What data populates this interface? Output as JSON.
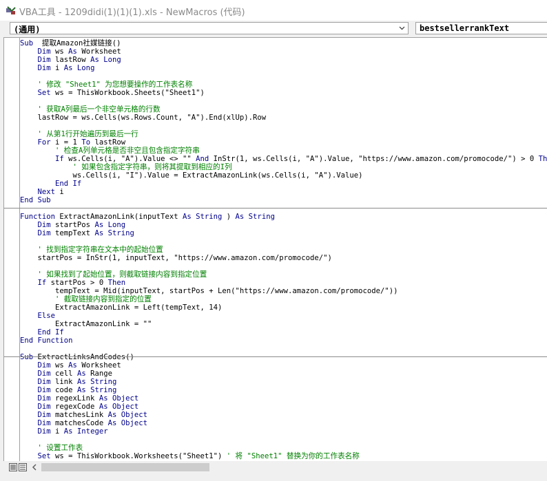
{
  "window": {
    "title": "VBA工具 - 1209didi(1)(1)(1).xls - NewMacros (代码)"
  },
  "object_combo": {
    "value": "(通用)"
  },
  "procedure_combo": {
    "value": "bestsellerrankText"
  },
  "code_lines": [
    [
      [
        "kw",
        "Sub"
      ],
      [
        "",
        "  提取Amazon社媒链接()"
      ]
    ],
    [
      [
        "",
        "    "
      ],
      [
        "kw",
        "Dim"
      ],
      [
        "",
        " ws "
      ],
      [
        "kw",
        "As"
      ],
      [
        "",
        " Worksheet"
      ]
    ],
    [
      [
        "",
        "    "
      ],
      [
        "kw",
        "Dim"
      ],
      [
        "",
        " lastRow "
      ],
      [
        "kw",
        "As Long"
      ]
    ],
    [
      [
        "",
        "    "
      ],
      [
        "kw",
        "Dim"
      ],
      [
        "",
        " i "
      ],
      [
        "kw",
        "As Long"
      ]
    ],
    [],
    [
      [
        "cm",
        "    ' 修改 \"Sheet1\" 为您想要操作的工作表名称"
      ]
    ],
    [
      [
        "",
        "    "
      ],
      [
        "kw",
        "Set"
      ],
      [
        "",
        " ws = ThisWorkbook.Sheets(\"Sheet1\")"
      ]
    ],
    [],
    [
      [
        "cm",
        "    ' 获取A列最后一个非空单元格的行数"
      ]
    ],
    [
      [
        "",
        "    lastRow = ws.Cells(ws.Rows.Count, \"A\").End(xlUp).Row"
      ]
    ],
    [],
    [
      [
        "cm",
        "    ' 从第1行开始遍历到最后一行"
      ]
    ],
    [
      [
        "",
        "    "
      ],
      [
        "kw",
        "For"
      ],
      [
        "",
        " i = 1 "
      ],
      [
        "kw",
        "To"
      ],
      [
        "",
        " lastRow"
      ]
    ],
    [
      [
        "cm",
        "        ' 检查A列单元格是否非空且包含指定字符串"
      ]
    ],
    [
      [
        "",
        "        "
      ],
      [
        "kw",
        "If"
      ],
      [
        "",
        " ws.Cells(i, \"A\").Value <> \"\" "
      ],
      [
        "kw",
        "And"
      ],
      [
        "",
        " InStr(1, ws.Cells(i, \"A\").Value, \"https://www.amazon.com/promocode/\") > 0 "
      ],
      [
        "kw",
        "Then"
      ]
    ],
    [
      [
        "cm",
        "            ' 如果包含指定字符串，则将其提取到相应的I列"
      ]
    ],
    [
      [
        "",
        "            ws.Cells(i, \"I\").Value = ExtractAmazonLink(ws.Cells(i, \"A\").Value)"
      ]
    ],
    [
      [
        "",
        "        "
      ],
      [
        "kw",
        "End If"
      ]
    ],
    [
      [
        "",
        "    "
      ],
      [
        "kw",
        "Next"
      ],
      [
        "",
        " i"
      ]
    ],
    [
      [
        "kw",
        "End Sub"
      ]
    ],
    [],
    [
      [
        "kw",
        "Function"
      ],
      [
        "",
        " ExtractAmazonLink(inputText "
      ],
      [
        "kw",
        "As String"
      ],
      [
        "",
        " ) "
      ],
      [
        "kw",
        "As String"
      ]
    ],
    [
      [
        "",
        "    "
      ],
      [
        "kw",
        "Dim"
      ],
      [
        "",
        " startPos "
      ],
      [
        "kw",
        "As Long"
      ]
    ],
    [
      [
        "",
        "    "
      ],
      [
        "kw",
        "Dim"
      ],
      [
        "",
        " tempText "
      ],
      [
        "kw",
        "As String"
      ]
    ],
    [],
    [
      [
        "cm",
        "    ' 找到指定字符串在文本中的起始位置"
      ]
    ],
    [
      [
        "",
        "    startPos = InStr(1, inputText, \"https://www.amazon.com/promocode/\")"
      ]
    ],
    [],
    [
      [
        "cm",
        "    ' 如果找到了起始位置，则截取链接内容到指定位置"
      ]
    ],
    [
      [
        "",
        "    "
      ],
      [
        "kw",
        "If"
      ],
      [
        "",
        " startPos > 0 "
      ],
      [
        "kw",
        "Then"
      ]
    ],
    [
      [
        "",
        "        tempText = Mid(inputText, startPos + Len(\"https://www.amazon.com/promocode/\"))"
      ]
    ],
    [
      [
        "cm",
        "        ' 截取链接内容到指定的位置"
      ]
    ],
    [
      [
        "",
        "        ExtractAmazonLink = Left(tempText, 14)"
      ]
    ],
    [
      [
        "",
        "    "
      ],
      [
        "kw",
        "Else"
      ]
    ],
    [
      [
        "",
        "        ExtractAmazonLink = \"\""
      ]
    ],
    [
      [
        "",
        "    "
      ],
      [
        "kw",
        "End If"
      ]
    ],
    [
      [
        "kw",
        "End Function"
      ]
    ],
    [],
    [
      [
        "kw",
        "Sub"
      ],
      [
        "",
        " ExtractLinksAndCodes()"
      ]
    ],
    [
      [
        "",
        "    "
      ],
      [
        "kw",
        "Dim"
      ],
      [
        "",
        " ws "
      ],
      [
        "kw",
        "As"
      ],
      [
        "",
        " Worksheet"
      ]
    ],
    [
      [
        "",
        "    "
      ],
      [
        "kw",
        "Dim"
      ],
      [
        "",
        " cell "
      ],
      [
        "kw",
        "As"
      ],
      [
        "",
        " Range"
      ]
    ],
    [
      [
        "",
        "    "
      ],
      [
        "kw",
        "Dim"
      ],
      [
        "",
        " link "
      ],
      [
        "kw",
        "As String"
      ]
    ],
    [
      [
        "",
        "    "
      ],
      [
        "kw",
        "Dim"
      ],
      [
        "",
        " code "
      ],
      [
        "kw",
        "As String"
      ]
    ],
    [
      [
        "",
        "    "
      ],
      [
        "kw",
        "Dim"
      ],
      [
        "",
        " regexLink "
      ],
      [
        "kw",
        "As Object"
      ]
    ],
    [
      [
        "",
        "    "
      ],
      [
        "kw",
        "Dim"
      ],
      [
        "",
        " regexCode "
      ],
      [
        "kw",
        "As Object"
      ]
    ],
    [
      [
        "",
        "    "
      ],
      [
        "kw",
        "Dim"
      ],
      [
        "",
        " matchesLink "
      ],
      [
        "kw",
        "As Object"
      ]
    ],
    [
      [
        "",
        "    "
      ],
      [
        "kw",
        "Dim"
      ],
      [
        "",
        " matchesCode "
      ],
      [
        "kw",
        "As Object"
      ]
    ],
    [
      [
        "",
        "    "
      ],
      [
        "kw",
        "Dim"
      ],
      [
        "",
        " i "
      ],
      [
        "kw",
        "As Integer"
      ]
    ],
    [],
    [
      [
        "cm",
        "    ' 设置工作表"
      ]
    ],
    [
      [
        "",
        "    "
      ],
      [
        "kw",
        "Set"
      ],
      [
        "",
        " ws = ThisWorkbook.Worksheets(\"Sheet1\") "
      ],
      [
        "cm",
        "' 将 \"Sheet1\" 替换为你的工作表名称"
      ]
    ]
  ],
  "colors": {
    "keyword": "#00008b",
    "comment": "#008000",
    "text": "#000000"
  }
}
